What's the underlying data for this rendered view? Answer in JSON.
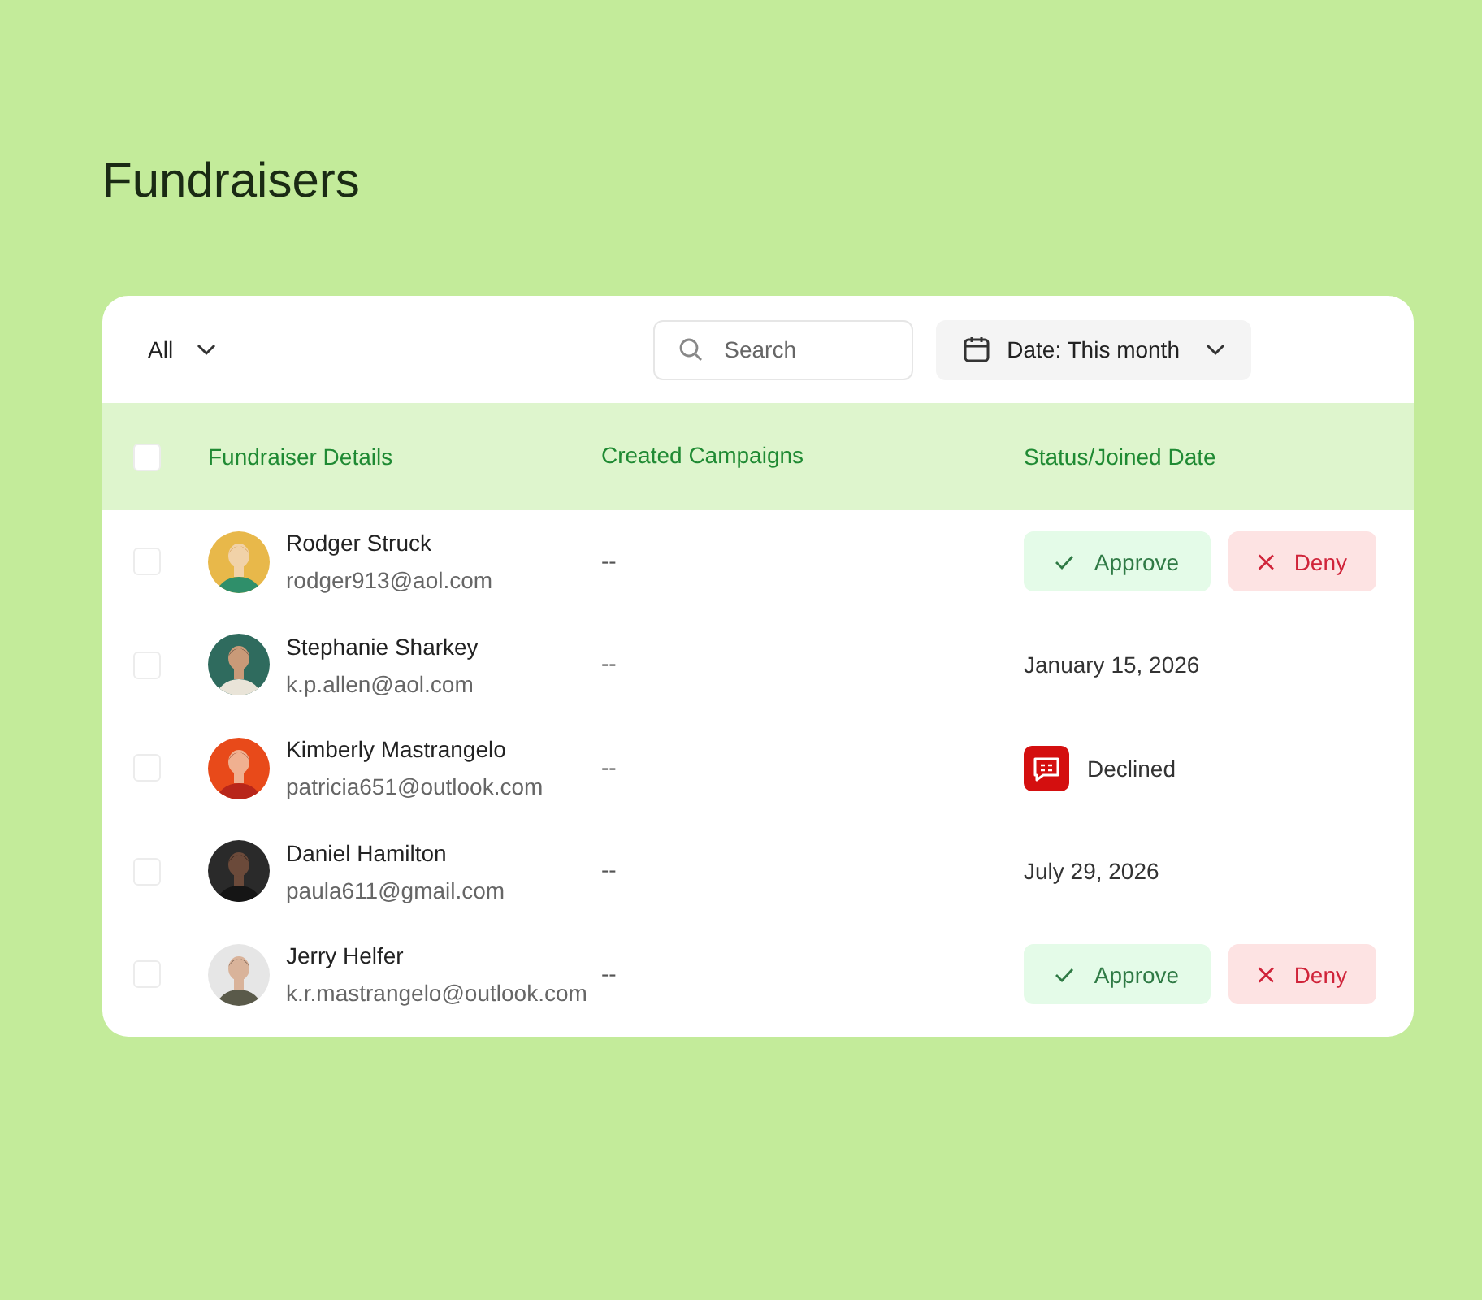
{
  "title": "Fundraisers",
  "filter": {
    "label": "All"
  },
  "search": {
    "placeholder": "Search"
  },
  "date_filter": {
    "label": "Date: This month"
  },
  "table": {
    "header_checkbox": {
      "checked": false
    },
    "columns": [
      "Fundraiser Details",
      "Created Campaigns",
      "Status/Joined Date"
    ],
    "rows": [
      {
        "checked": false,
        "name": "Rodger Struck",
        "email": "rodger913@aol.com",
        "campaigns": "--",
        "status": {
          "kind": "actions",
          "approve": "Approve",
          "deny": "Deny"
        }
      },
      {
        "checked": false,
        "name": "Stephanie Sharkey",
        "email": "k.p.allen@aol.com",
        "campaigns": "--",
        "status": {
          "kind": "date",
          "text": "January 15, 2026"
        }
      },
      {
        "checked": false,
        "name": "Kimberly Mastrangelo",
        "email": "patricia651@outlook.com",
        "campaigns": "--",
        "status": {
          "kind": "declined",
          "text": "Declined"
        }
      },
      {
        "checked": false,
        "name": "Daniel Hamilton",
        "email": "paula611@gmail.com",
        "campaigns": "--",
        "status": {
          "kind": "date",
          "text": "July 29, 2026"
        }
      },
      {
        "checked": false,
        "name": "Jerry Helfer",
        "email": "k.r.mastrangelo@outlook.com",
        "campaigns": "--",
        "status": {
          "kind": "actions",
          "approve": "Approve",
          "deny": "Deny"
        }
      }
    ]
  }
}
